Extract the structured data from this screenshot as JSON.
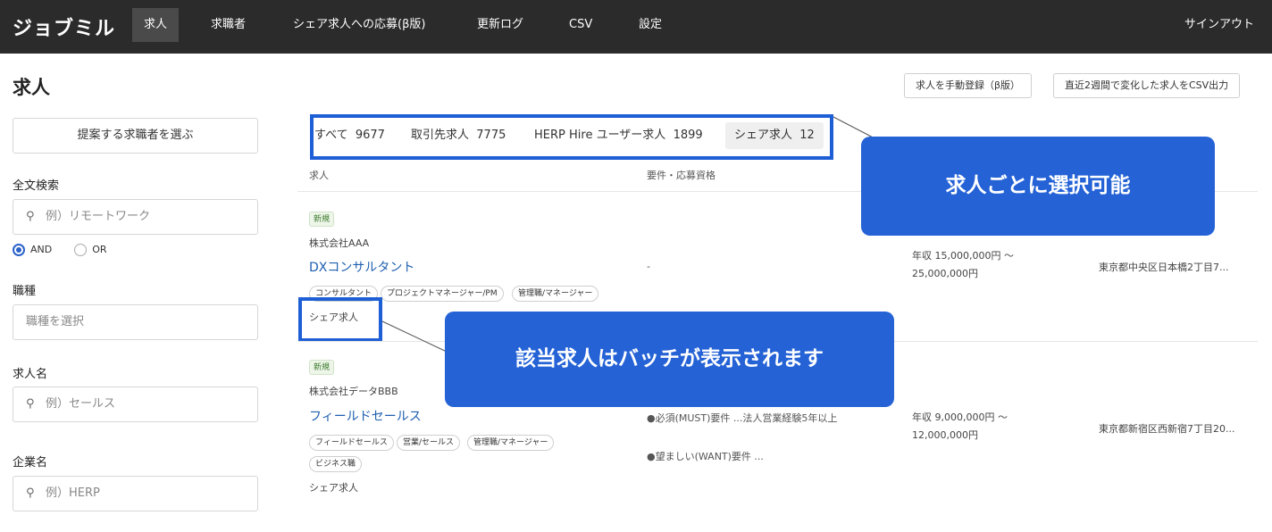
{
  "app": {
    "logo": "ジョブミル",
    "nav": [
      "求人",
      "求職者",
      "シェア求人への応募(β版)",
      "更新ログ",
      "CSV",
      "設定"
    ],
    "signout": "サインアウト"
  },
  "header": {
    "title": "求人",
    "manual_register_label": "求人を手動登録（β版）",
    "csv_export_label": "直近2週間で変化した求人をCSV出力"
  },
  "sidebar": {
    "propose_button": "提案する求職者を選ぶ",
    "fulltext_label": "全文検索",
    "fulltext_placeholder": "例）リモートワーク",
    "radio_and": "AND",
    "radio_or": "OR",
    "jobtype_label": "職種",
    "jobtype_placeholder": "職種を選択",
    "jobname_label": "求人名",
    "jobname_placeholder": "例）セールス",
    "company_label": "企業名",
    "company_placeholder": "例）HERP"
  },
  "tabs": [
    {
      "label": "すべて",
      "count": "9677"
    },
    {
      "label": "取引先求人",
      "count": "7775"
    },
    {
      "label": "HERP Hire ユーザー求人",
      "count": "1899"
    },
    {
      "label": "シェア求人",
      "count": "12"
    }
  ],
  "columns": {
    "job": "求人",
    "requirements": "要件・応募資格"
  },
  "rows": [
    {
      "badge": "新規",
      "company": "株式会社AAA",
      "title": "DXコンサルタント",
      "tags": [
        "コンサルタント",
        "プロジェクトマネージャー/PM",
        "管理職/マネージャー"
      ],
      "share": "シェア求人",
      "requirement": "-",
      "salary_line1": "年収 15,000,000円 〜",
      "salary_line2": "25,000,000円",
      "location": "東京都中央区日本橋2丁目7..."
    },
    {
      "badge": "新規",
      "company": "株式会社データBBB",
      "title": "フィールドセールス",
      "tags": [
        "フィールドセールス",
        "営業/セールス",
        "管理職/マネージャー",
        "ビジネス職"
      ],
      "share": "シェア求人",
      "requirement": "●必須(MUST)要件 ...法人営業経験5年以上",
      "requirement_want": "●望ましい(WANT)要件 ...",
      "salary_line1": "年収 9,000,000円 〜",
      "salary_line2": "12,000,000円",
      "location": "東京都新宿区西新宿7丁目20..."
    }
  ],
  "callouts": {
    "select_per_job": "求人ごとに選択可能",
    "badge_shown": "該当求人はバッチが表示されます"
  },
  "colors": {
    "accent": "#2462d6",
    "topbar": "#2b2b2b",
    "link": "#1f5fb0"
  }
}
